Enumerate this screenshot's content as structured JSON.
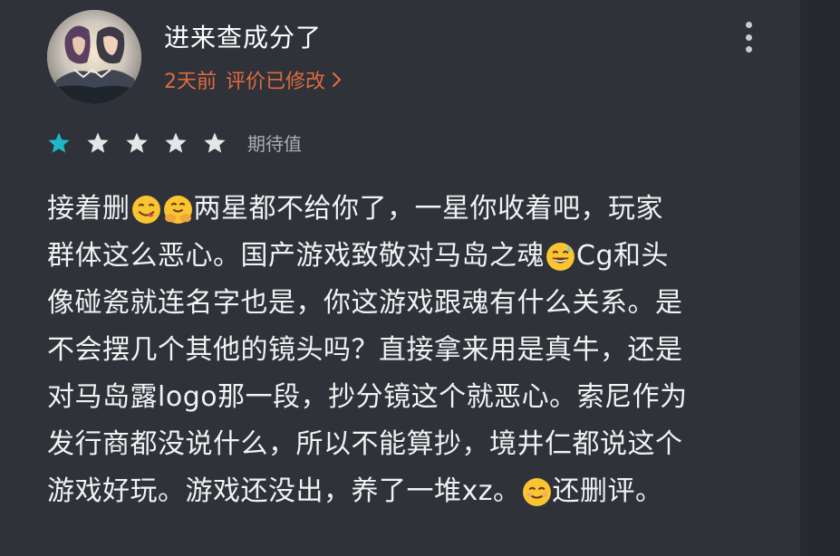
{
  "review": {
    "username": "进来查成分了",
    "time": "2天前",
    "edited": "评价已修改",
    "rating": 1,
    "rating_max": 5,
    "rating_label": "期待值",
    "colors": {
      "star_filled": "#1fb7c9",
      "star_empty": "#e6e6e6",
      "meta": "#e06a3f"
    },
    "lines": [
      [
        "接着删",
        "[face-savoring-food-emoji]",
        "[hugging-face-emoji]",
        "两星都不给你了，一星你收着吧，玩家"
      ],
      [
        "群体这么恶心。国产游戏致敬对马岛之魂",
        "[grinning-sweat-emoji]",
        "Cg和头"
      ],
      [
        "像碰瓷就连名字也是，你这游戏跟魂有什么关系。是"
      ],
      [
        "不会摆几个其他的镜头吗？直接拿来用是真牛，还是"
      ],
      [
        "对马岛露logo那一段，抄分镜这个就恶心。索尼作为"
      ],
      [
        "发行商都没说什么，所以不能算抄，境井仁都说这个"
      ],
      [
        "游戏好玩。游戏还没出，养了一堆xz。",
        "[smiling-face-emoji]",
        "还删评。"
      ]
    ]
  }
}
